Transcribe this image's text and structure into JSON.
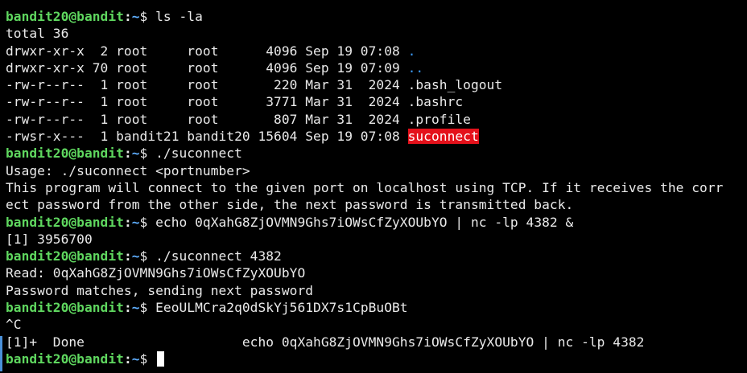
{
  "terminal": {
    "user": "bandit20@bandit",
    "sep": ":",
    "path": "~",
    "dollar": "$ ",
    "lines": [
      {
        "kind": "prompt",
        "cmd": "ls -la"
      },
      {
        "kind": "out",
        "text": "total 36"
      },
      {
        "kind": "ls",
        "text": "drwxr-xr-x  2 root     root      4096 Sep 19 07:08 ",
        "name": ".",
        "style": "dir"
      },
      {
        "kind": "ls",
        "text": "drwxr-xr-x 70 root     root      4096 Sep 19 07:09 ",
        "name": "..",
        "style": "dir"
      },
      {
        "kind": "ls",
        "text": "-rw-r--r--  1 root     root       220 Mar 31  2024 ",
        "name": ".bash_logout",
        "style": "file"
      },
      {
        "kind": "ls",
        "text": "-rw-r--r--  1 root     root      3771 Mar 31  2024 ",
        "name": ".bashrc",
        "style": "file"
      },
      {
        "kind": "ls",
        "text": "-rw-r--r--  1 root     root       807 Mar 31  2024 ",
        "name": ".profile",
        "style": "file"
      },
      {
        "kind": "ls",
        "text": "-rwsr-x---  1 bandit21 bandit20 15604 Sep 19 07:08 ",
        "name": "suconnect",
        "style": "suid"
      },
      {
        "kind": "prompt",
        "cmd": "./suconnect"
      },
      {
        "kind": "out",
        "text": "Usage: ./suconnect <portnumber>"
      },
      {
        "kind": "out",
        "text": "This program will connect to the given port on localhost using TCP. If it receives the corr"
      },
      {
        "kind": "out",
        "text": "ect password from the other side, the next password is transmitted back."
      },
      {
        "kind": "prompt",
        "cmd": "echo 0qXahG8ZjOVMN9Ghs7iOWsCfZyXOUbYO | nc -lp 4382 &"
      },
      {
        "kind": "out",
        "text": "[1] 3956700"
      },
      {
        "kind": "prompt",
        "cmd": "./suconnect 4382"
      },
      {
        "kind": "out",
        "text": "Read: 0qXahG8ZjOVMN9Ghs7iOWsCfZyXOUbYO"
      },
      {
        "kind": "out",
        "text": "Password matches, sending next password"
      },
      {
        "kind": "prompt",
        "cmd": "EeoULMCra2q0dSkYj561DX7s1CpBuOBt"
      },
      {
        "kind": "out",
        "text": "^C"
      },
      {
        "kind": "out",
        "text": "[1]+  Done                    echo 0qXahG8ZjOVMN9Ghs7iOWsCfZyXOUbYO | nc -lp 4382"
      },
      {
        "kind": "prompt",
        "cmd": "",
        "cursor": true
      }
    ]
  },
  "colors": {
    "background": "#000000",
    "foreground": "#eaeaea",
    "prompt_user": "#5fd75f",
    "prompt_path": "#5fafff",
    "dir": "#3b9cff",
    "suid_bg": "#e4111b"
  }
}
